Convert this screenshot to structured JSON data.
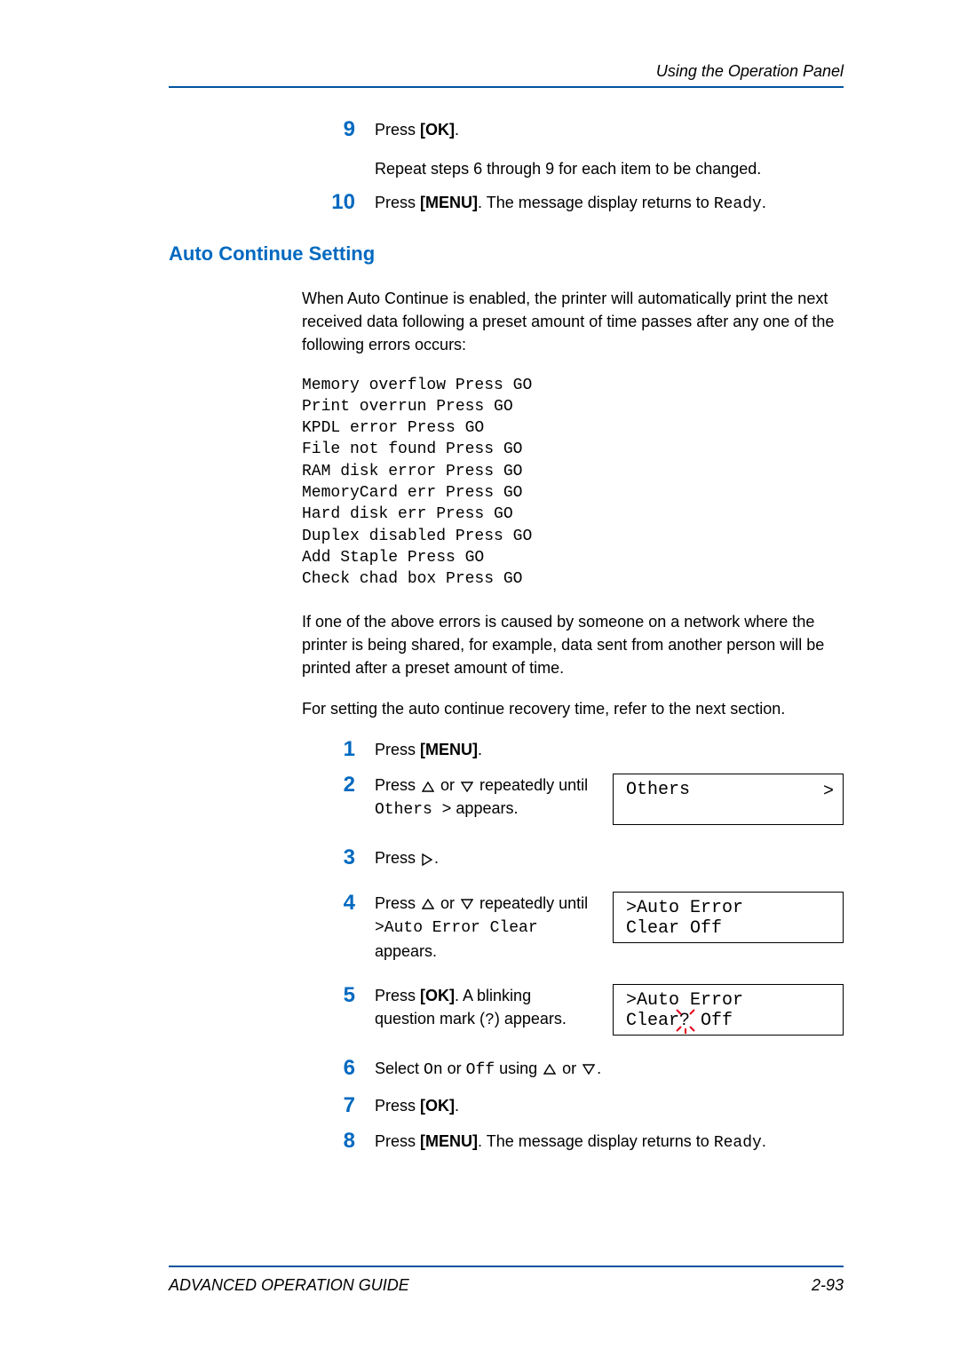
{
  "header": {
    "running_title": "Using the Operation Panel"
  },
  "top_steps": {
    "s9": {
      "num": "9",
      "line1_prefix": "Press ",
      "line1_bold": "[OK]",
      "line1_suffix": ".",
      "line2": "Repeat steps 6 through 9 for each item to be changed."
    },
    "s10": {
      "num": "10",
      "prefix": "Press ",
      "bold": "[MENU]",
      "mid": ". The message display returns to ",
      "mono": "Ready",
      "suffix": "."
    }
  },
  "section": {
    "heading": "Auto Continue Setting",
    "intro": "When Auto Continue is enabled, the printer will automatically print the next received data following a preset amount of time passes after any one of the following errors occurs:",
    "error_list": "Memory overflow Press GO\nPrint overrun Press GO\nKPDL error Press GO\nFile not found Press GO\nRAM disk error Press GO\nMemoryCard err Press GO\nHard disk err Press GO\nDuplex disabled Press GO\nAdd Staple Press GO\nCheck chad box Press GO",
    "para2": "If one of the above errors is caused by someone on a network where the printer is being shared, for example, data sent from another person will be printed after a preset amount of time.",
    "para3": "For setting the auto continue recovery time, refer to the next section."
  },
  "steps": {
    "s1": {
      "num": "1",
      "prefix": "Press ",
      "bold": "[MENU]",
      "suffix": "."
    },
    "s2": {
      "num": "2",
      "prefix": "Press ",
      "mid": " or ",
      "after": " repeatedly until ",
      "mono": "Others  >",
      "suffix": " appears.",
      "lcd_text": "Others",
      "lcd_arrow": ">"
    },
    "s3": {
      "num": "3",
      "prefix": "Press ",
      "suffix": "."
    },
    "s4": {
      "num": "4",
      "prefix": "Press ",
      "mid": " or ",
      "after": " repeatedly until ",
      "mono": ">Auto Error Clear",
      "suffix": " appears.",
      "lcd_line1": ">Auto Error",
      "lcd_line2": " Clear  Off"
    },
    "s5": {
      "num": "5",
      "prefix": "Press ",
      "bold": "[OK]",
      "mid": ". A blinking question mark (",
      "mono_q": "?",
      "suffix": ") appears.",
      "lcd_line1": ">Auto Error",
      "lcd_line2_a": " Clear",
      "lcd_q": "?",
      "lcd_line2_b": " Off"
    },
    "s6": {
      "num": "6",
      "prefix": "Select ",
      "mono_on": "On",
      "mid1": " or ",
      "mono_off": "Off",
      "mid2": " using ",
      "mid3": " or ",
      "suffix": "."
    },
    "s7": {
      "num": "7",
      "prefix": "Press ",
      "bold": "[OK]",
      "suffix": "."
    },
    "s8": {
      "num": "8",
      "prefix": "Press ",
      "bold": "[MENU]",
      "mid": ". The message display returns to ",
      "mono": "Ready",
      "suffix": "."
    }
  },
  "footer": {
    "left": "ADVANCED OPERATION GUIDE",
    "right": "2-93"
  }
}
